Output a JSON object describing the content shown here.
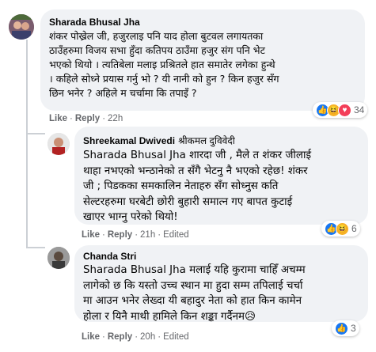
{
  "comments": [
    {
      "author": "Sharada Bhusal Jha",
      "text": "शंकर पोख्रेल जी, हजुरलाइ पनि याद होला बुटवल लगायतका\nठाउँहरुमा विजय सभा हुँदा कतिपय ठाउँमा हजुर संग पनि भेट\nभएको थियो । त्यतिबेला मलाइ प्रश्रितले हात समातेर लगेका हुन्थे\n। कहिले सोध्ने प्रयास गर्नु भो ? यी नानी को हुन ? किन हजुर सँग\nछिन भनेर ? अहिले म चर्चामा कि तपाइँ ?",
      "like": "Like",
      "reply": "Reply",
      "time": "22h",
      "reaction_count": "34",
      "reactions": [
        "like-icon",
        "haha-icon",
        "love-icon"
      ]
    },
    {
      "author": "Shreekamal Dwivedi",
      "author_alt": "श्रीकमल दुविवेदी",
      "mention": "Sharada Bhusal Jha",
      "text": " शारदा जी , मैले त शंकर जीलाई\nथाहा नभएको भन्ठानेको त सँगै भेटनु नै भएको रहेछ! शंकर\nजी ; पिडकका समकालिन नेताहरु सँग सोध्नुस कति\nसेल्टरहरुमा घरबेटी छोरी बुहारी समात्न गए बापत कुटाई\nखाएर भाग्नु परेको थियो!",
      "like": "Like",
      "reply": "Reply",
      "time": "21h",
      "edited": "Edited",
      "reaction_count": "6",
      "reactions": [
        "like-icon",
        "haha-icon"
      ]
    },
    {
      "author": "Chanda Stri",
      "mention": "Sharada Bhusal Jha",
      "text": " मलाई यहि कुरामा चाहिँ अचम्म\nलागेको छ कि यस्तो उच्च स्थान मा हुदा सम्म तपिलाई चर्चा\nमा आउन भनेर लेख्दा यी बहादुर नेता को हात किन कामेन\nहोला र यिनै माथी हामिले किन शङ्का गर्दैनम😥",
      "like": "Like",
      "reply": "Reply",
      "time": "20h",
      "edited": "Edited",
      "reaction_count": "3",
      "reactions": [
        "like-icon"
      ]
    }
  ],
  "colors": {
    "bubble": "#f0f2f5",
    "meta": "#65676b",
    "like_blue": "#1877f2",
    "haha_yellow": "#f7b125",
    "love_red": "#f33e58"
  }
}
